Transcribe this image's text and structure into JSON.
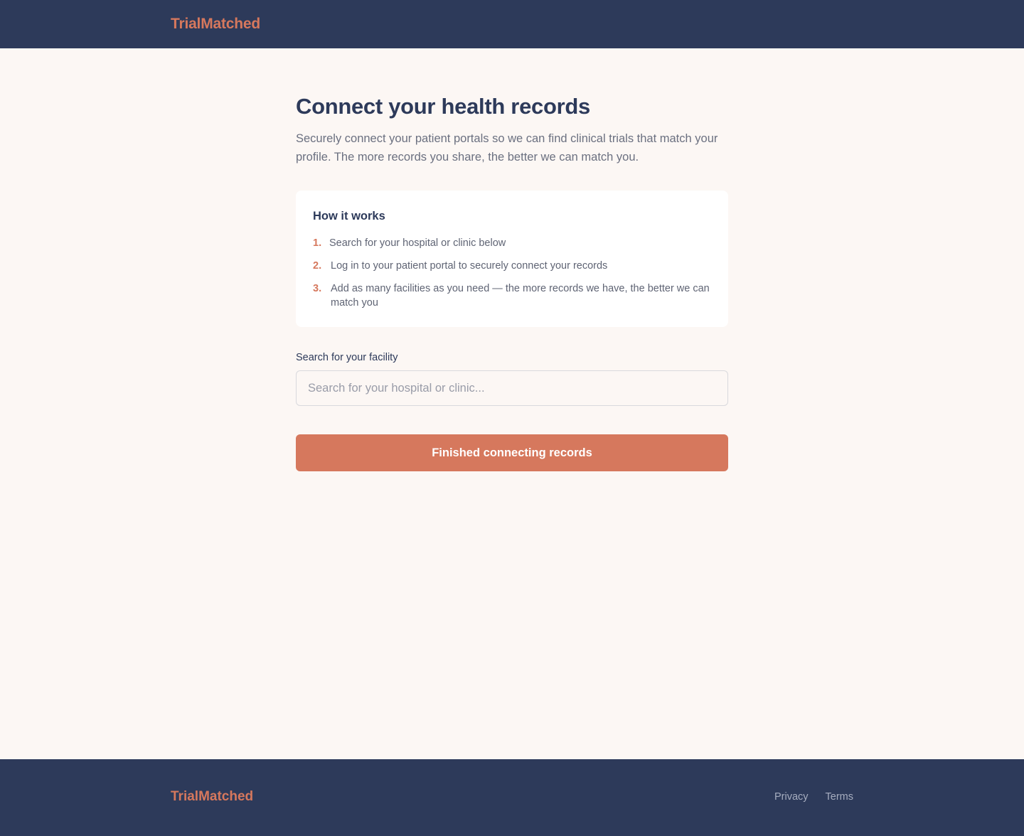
{
  "header": {
    "brand": "TrialMatched"
  },
  "main": {
    "title": "Connect your health records",
    "subtitle": "Securely connect your patient portals so we can find clinical trials that match your profile. The more records you share, the better we can match you.",
    "how_it_works": {
      "title": "How it works",
      "steps": [
        {
          "number": "1.",
          "text": "Search for your hospital or clinic below"
        },
        {
          "number": "2.",
          "text": "Log in to your patient portal to securely connect your records"
        },
        {
          "number": "3.",
          "text": "Add as many facilities as you need — the more records we have, the better we can match you"
        }
      ]
    },
    "search": {
      "label": "Search for your facility",
      "placeholder": "Search for your hospital or clinic...",
      "value": ""
    },
    "finish_button_label": "Finished connecting records"
  },
  "footer": {
    "brand": "TrialMatched",
    "links": [
      {
        "label": "Privacy"
      },
      {
        "label": "Terms"
      }
    ]
  },
  "colors": {
    "navy": "#2d3a5a",
    "accent": "#d6785d",
    "background": "#fcf7f4",
    "card": "#ffffff"
  }
}
